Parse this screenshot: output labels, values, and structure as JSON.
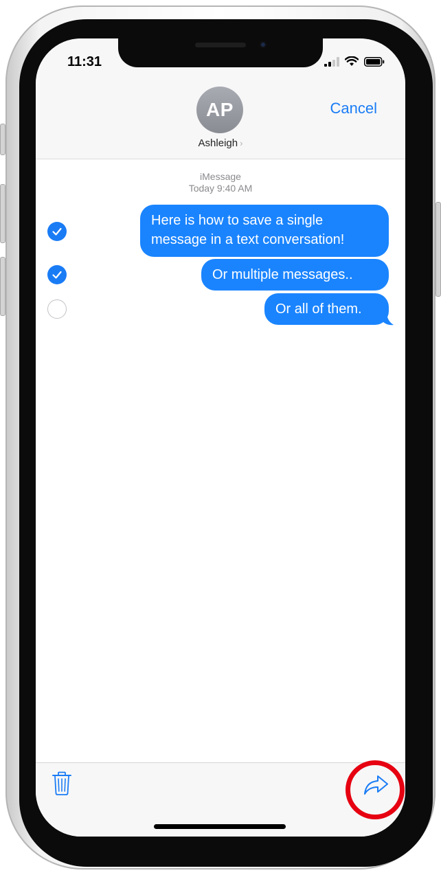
{
  "status_bar": {
    "time": "11:31",
    "icons": [
      "cellular-signal-icon",
      "wifi-icon",
      "battery-icon"
    ]
  },
  "header": {
    "avatar_initials": "AP",
    "contact_name": "Ashleigh",
    "cancel_label": "Cancel"
  },
  "conversation": {
    "service": "iMessage",
    "timestamp": "Today 9:40 AM",
    "messages": [
      {
        "text_line1": "Here is how to save a single",
        "text_line2": "message in a text conversation!",
        "selected": true
      },
      {
        "text": "Or multiple messages..",
        "selected": true
      },
      {
        "text": "Or all of them.",
        "selected": false
      }
    ]
  },
  "toolbar": {
    "delete_icon": "trash-icon",
    "forward_icon": "share-arrow-icon"
  },
  "colors": {
    "accent": "#1a7cf5",
    "bubble": "#1a84ff",
    "highlight": "#e60011"
  }
}
